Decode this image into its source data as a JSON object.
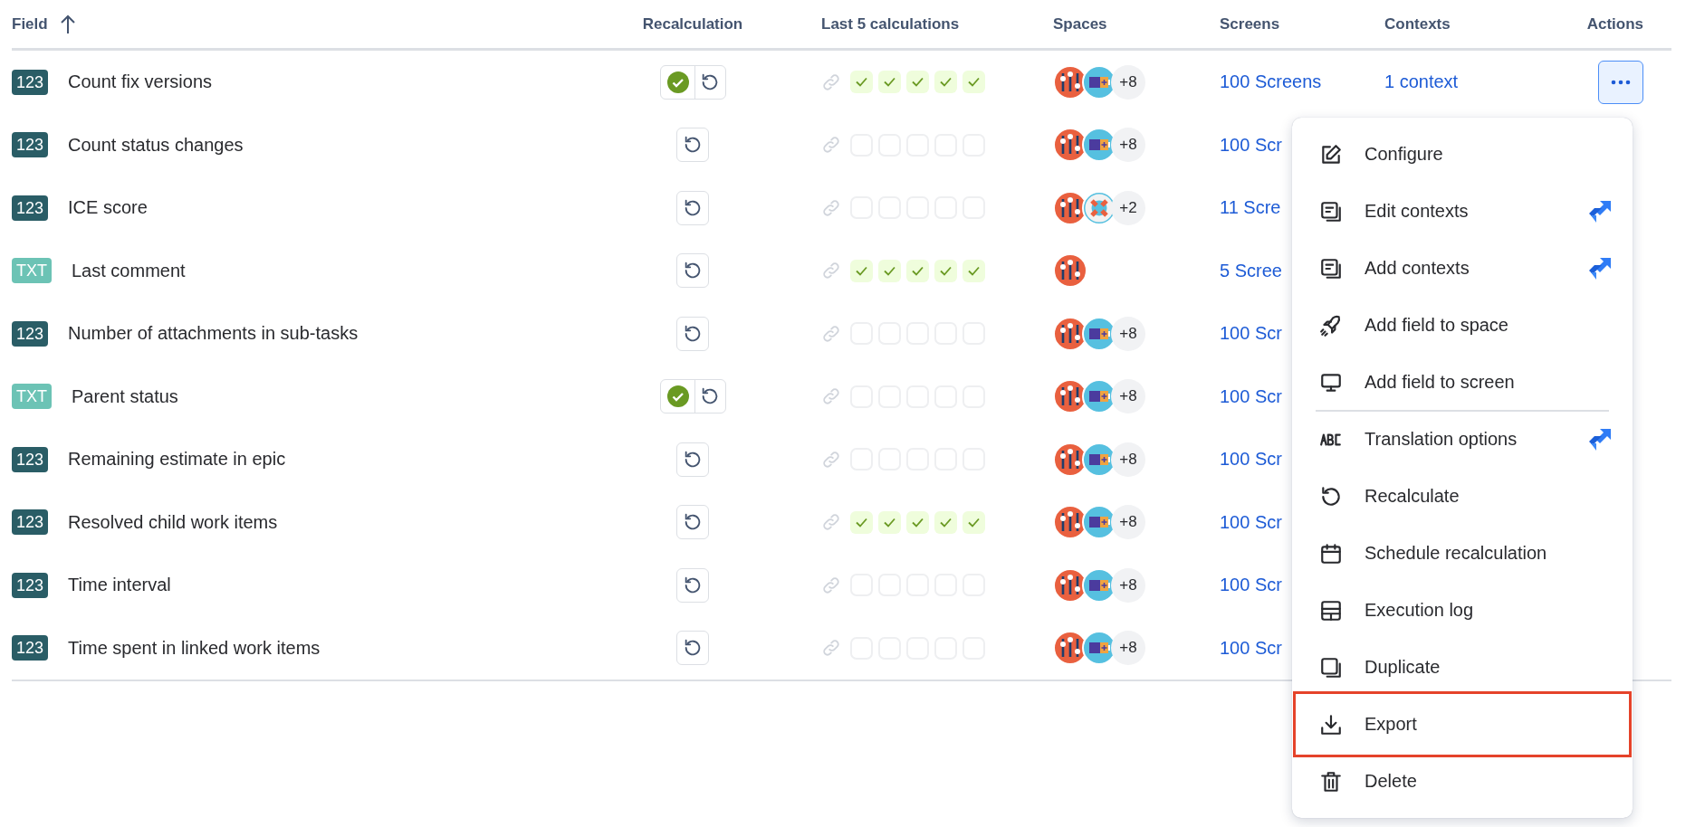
{
  "table": {
    "columns": [
      {
        "label": "Field",
        "sorted": true
      },
      {
        "label": "Recalculation",
        "sorted": false
      },
      {
        "label": "Last 5 calculations",
        "sorted": false
      },
      {
        "label": "Spaces",
        "sorted": false
      },
      {
        "label": "Screens",
        "sorted": false
      },
      {
        "label": "Contexts",
        "sorted": false
      },
      {
        "label": "Actions",
        "sorted": false
      }
    ],
    "rows": [
      {
        "kind": "number",
        "badge": "123",
        "name": "Count fix versions",
        "recalc_ok": true,
        "calcs": [
          true,
          true,
          true,
          true,
          true
        ],
        "spaces": [
          {
            "kind": "sliders"
          },
          {
            "kind": "battery"
          }
        ],
        "more_spaces": "+8",
        "screens": "100 Screens",
        "contexts": "1 context",
        "menu_open": true
      },
      {
        "kind": "number",
        "badge": "123",
        "name": "Count status changes",
        "recalc_ok": false,
        "calcs": [
          false,
          false,
          false,
          false,
          false
        ],
        "spaces": [
          {
            "kind": "sliders"
          },
          {
            "kind": "battery"
          }
        ],
        "more_spaces": "+8",
        "screens": "100 Scr"
      },
      {
        "kind": "number",
        "badge": "123",
        "name": "ICE score",
        "recalc_ok": false,
        "calcs": [
          false,
          false,
          false,
          false,
          false
        ],
        "spaces": [
          {
            "kind": "sliders"
          },
          {
            "kind": "lifebuoy"
          }
        ],
        "more_spaces": "+2",
        "screens": "11 Scre"
      },
      {
        "kind": "text",
        "badge": "TXT",
        "name": "Last comment",
        "recalc_ok": false,
        "calcs": [
          true,
          true,
          true,
          true,
          true
        ],
        "spaces": [
          {
            "kind": "sliders"
          }
        ],
        "screens": "5 Scree"
      },
      {
        "kind": "number",
        "badge": "123",
        "name": "Number of attachments in sub-tasks",
        "recalc_ok": false,
        "calcs": [
          false,
          false,
          false,
          false,
          false
        ],
        "spaces": [
          {
            "kind": "sliders"
          },
          {
            "kind": "battery"
          }
        ],
        "more_spaces": "+8",
        "screens": "100 Scr"
      },
      {
        "kind": "text",
        "badge": "TXT",
        "name": "Parent status",
        "recalc_ok": true,
        "calcs": [
          false,
          false,
          false,
          false,
          false
        ],
        "spaces": [
          {
            "kind": "sliders"
          },
          {
            "kind": "battery"
          }
        ],
        "more_spaces": "+8",
        "screens": "100 Scr"
      },
      {
        "kind": "number",
        "badge": "123",
        "name": "Remaining estimate in epic",
        "recalc_ok": false,
        "calcs": [
          false,
          false,
          false,
          false,
          false
        ],
        "spaces": [
          {
            "kind": "sliders"
          },
          {
            "kind": "battery"
          }
        ],
        "more_spaces": "+8",
        "screens": "100 Scr"
      },
      {
        "kind": "number",
        "badge": "123",
        "name": "Resolved child work items",
        "recalc_ok": false,
        "calcs": [
          true,
          true,
          true,
          true,
          true
        ],
        "spaces": [
          {
            "kind": "sliders"
          },
          {
            "kind": "battery"
          }
        ],
        "more_spaces": "+8",
        "screens": "100 Scr"
      },
      {
        "kind": "number",
        "badge": "123",
        "name": "Time interval",
        "recalc_ok": false,
        "calcs": [
          false,
          false,
          false,
          false,
          false
        ],
        "spaces": [
          {
            "kind": "sliders"
          },
          {
            "kind": "battery"
          }
        ],
        "more_spaces": "+8",
        "screens": "100 Scr"
      },
      {
        "kind": "number",
        "badge": "123",
        "name": "Time spent in linked work items",
        "recalc_ok": false,
        "calcs": [
          false,
          false,
          false,
          false,
          false
        ],
        "spaces": [
          {
            "kind": "sliders"
          },
          {
            "kind": "battery"
          }
        ],
        "more_spaces": "+8",
        "screens": "100 Scr"
      }
    ]
  },
  "menu": {
    "items": [
      {
        "label": "Configure",
        "jira": false,
        "divider_before": false,
        "highlighted": false
      },
      {
        "label": "Edit contexts",
        "jira": true,
        "divider_before": false,
        "highlighted": false
      },
      {
        "label": "Add contexts",
        "jira": true,
        "divider_before": false,
        "highlighted": false
      },
      {
        "label": "Add field to space",
        "jira": false,
        "divider_before": false,
        "highlighted": false
      },
      {
        "label": "Add field to screen",
        "jira": false,
        "divider_before": false,
        "highlighted": false
      },
      {
        "label": "Translation options",
        "jira": true,
        "divider_before": true,
        "highlighted": false
      },
      {
        "label": "Recalculate",
        "jira": false,
        "divider_before": false,
        "highlighted": false
      },
      {
        "label": "Schedule recalculation",
        "jira": false,
        "divider_before": false,
        "highlighted": false
      },
      {
        "label": "Execution log",
        "jira": false,
        "divider_before": false,
        "highlighted": false
      },
      {
        "label": "Duplicate",
        "jira": false,
        "divider_before": false,
        "highlighted": false
      },
      {
        "label": "Export",
        "jira": false,
        "divider_before": false,
        "highlighted": true
      },
      {
        "label": "Delete",
        "jira": false,
        "divider_before": false,
        "highlighted": false
      }
    ]
  }
}
